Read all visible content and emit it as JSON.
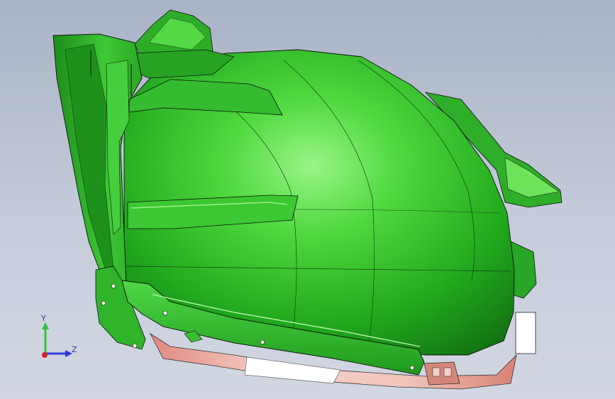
{
  "viewport": {
    "background_top": "#a9b3c6",
    "background_bottom": "#d2d7e2"
  },
  "model": {
    "primary_color": "#2fb02a",
    "highlight_color": "#8cf07a",
    "underside_color": "#e9a89c"
  },
  "triad": {
    "y_label": "Y",
    "z_label": "Z",
    "y_color": "#2ec43a",
    "z_color": "#2b3fd6",
    "x_color": "#d42222"
  }
}
